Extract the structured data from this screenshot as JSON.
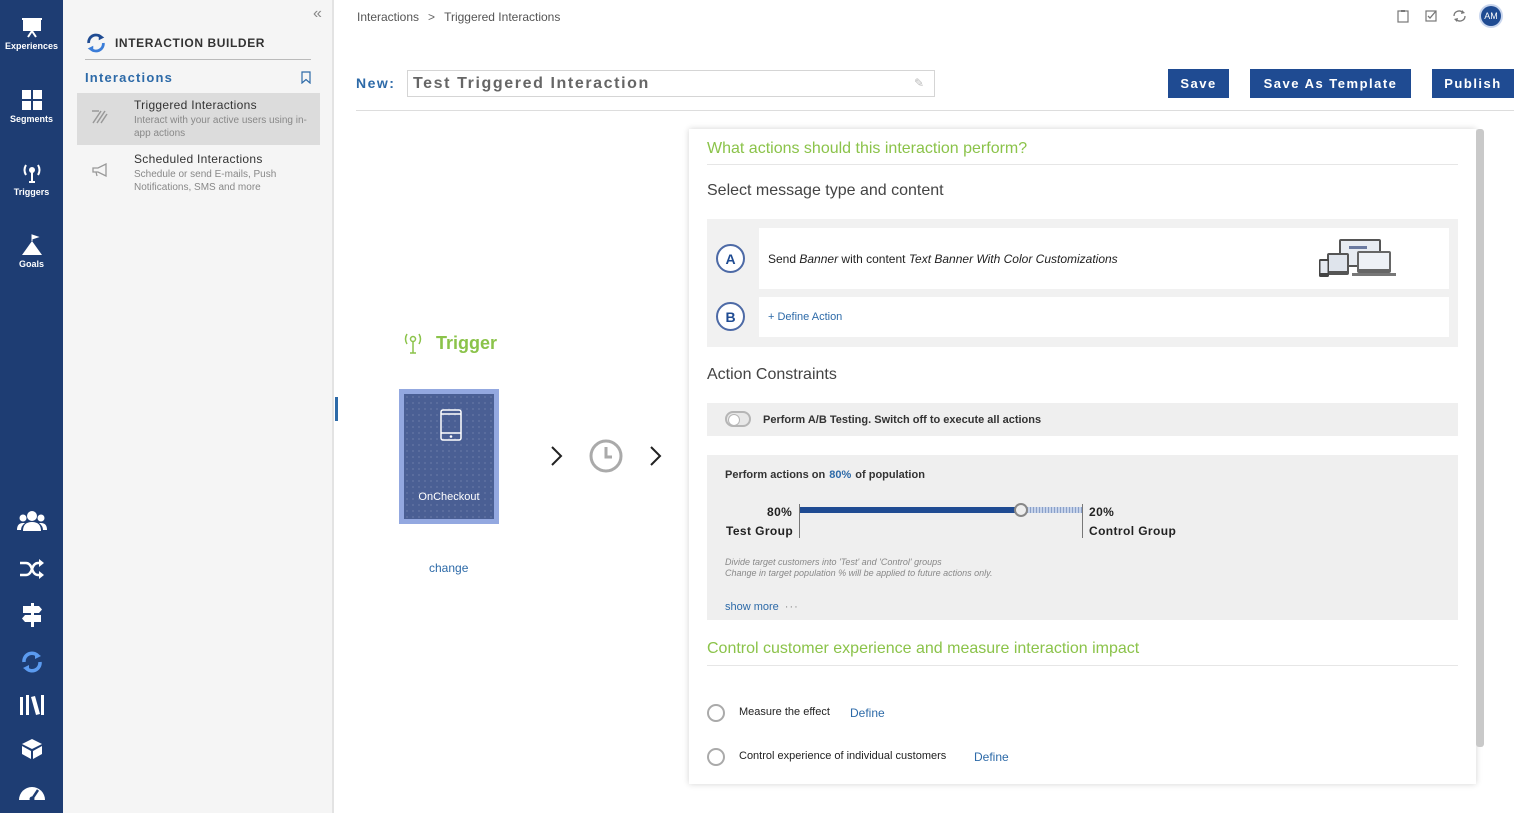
{
  "rail": {
    "items": [
      {
        "label": "Experiences"
      },
      {
        "label": "Segments"
      },
      {
        "label": "Triggers"
      },
      {
        "label": "Goals"
      }
    ]
  },
  "panel": {
    "title": "INTERACTION BUILDER",
    "section": "Interactions",
    "items": [
      {
        "name": "Triggered Interactions",
        "desc": "Interact with your active users using in-app actions"
      },
      {
        "name": "Scheduled Interactions",
        "desc": "Schedule or send E-mails, Push Notifications, SMS and more"
      }
    ]
  },
  "breadcrumb": {
    "root": "Interactions",
    "sep": ">",
    "current": "Triggered Interactions"
  },
  "user": {
    "initials": "AM"
  },
  "header": {
    "new_label": "New:",
    "name_value": "Test Triggered Interaction",
    "save": "Save",
    "save_template": "Save As Template",
    "publish": "Publish"
  },
  "trigger": {
    "title": "Trigger",
    "event": "OnCheckout",
    "change": "change"
  },
  "actions": {
    "heading": "What actions should this interaction perform?",
    "subheading": "Select message type and content",
    "a": {
      "letter": "A",
      "pre": "Send",
      "type": "Banner",
      "mid": "with content",
      "content": "Text Banner With Color Customizations"
    },
    "b": {
      "letter": "B",
      "define": "+ Define Action"
    }
  },
  "constraints": {
    "heading": "Action Constraints",
    "ab_label": "Perform A/B Testing. Switch off to execute all actions",
    "ab_enabled": false,
    "pop_pre": "Perform actions on",
    "pop_pct": "80%",
    "pop_post": "of population",
    "test_pct": "80%",
    "test_label": "Test Group",
    "control_pct": "20%",
    "control_label": "Control Group",
    "split_fraction": 0.8,
    "note1": "Divide target customers into 'Test' and 'Control' groups",
    "note2": "Change in target population % will be applied to future actions only.",
    "show_more": "show more",
    "dots": "···"
  },
  "impact": {
    "heading": "Control customer experience and measure interaction impact",
    "measure": "Measure the effect",
    "measure_define": "Define",
    "control": "Control experience of individual customers",
    "control_define": "Define"
  },
  "colors": {
    "rail": "#1e3d73",
    "primary": "#1f4b92",
    "green": "#8bc34a",
    "link": "#2d6aa8"
  }
}
